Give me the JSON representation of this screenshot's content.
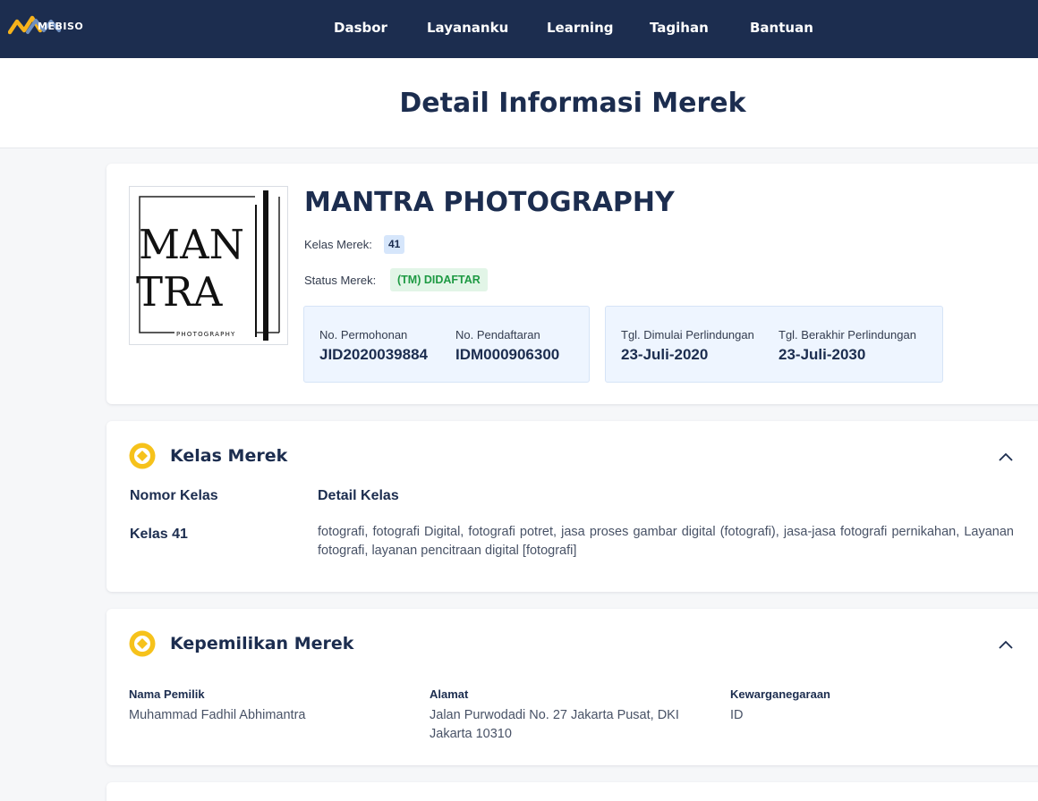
{
  "header": {
    "logo_text": "MEBISO",
    "nav": [
      "Dasbor",
      "Layananku",
      "Learning",
      "Tagihan",
      "Bantuan"
    ]
  },
  "page": {
    "title": "Detail Informasi Merek"
  },
  "brand": {
    "name": "MANTRA PHOTOGRAPHY",
    "logo_lettering": [
      "MAN",
      "TRA",
      "PHOTOGRAPHY"
    ],
    "class_label": "Kelas Merek:",
    "class_value": "41",
    "status_label": "Status Merek:",
    "status_value": "(TM) DIDAFTAR",
    "application_no_label": "No. Permohonan",
    "application_no": "JID2020039884",
    "registration_no_label": "No. Pendaftaran",
    "registration_no": "IDM000906300",
    "protection_start_label": "Tgl. Dimulai Perlindungan",
    "protection_start": "23-Juli-2020",
    "protection_end_label": "Tgl. Berakhir Perlindungan",
    "protection_end": "23-Juli-2030"
  },
  "class_section": {
    "title": "Kelas Merek",
    "col_number": "Nomor Kelas",
    "col_detail": "Detail Kelas",
    "number": "Kelas 41",
    "detail": "fotografi, fotografi Digital, fotografi potret, jasa proses gambar digital (fotografi), jasa-jasa fotografi pernikahan, Layanan fotografi, layanan pencitraan digital [fotografi]"
  },
  "ownership_section": {
    "title": "Kepemilikan Merek",
    "owner_label": "Nama Pemilik",
    "owner": "Muhammad Fadhil Abhimantra",
    "address_label": "Alamat",
    "address": "Jalan Purwodadi No. 27 Jakarta Pusat, DKI Jakarta 10310",
    "nationality_label": "Kewarganegaraan",
    "nationality": "ID"
  },
  "colors": {
    "navy": "#1c2d4f",
    "accent_yellow": "#f6c21b",
    "status_green": "#1e9a43",
    "info_bg": "#eef5ff"
  },
  "icons": {
    "section": "coin-diamond-icon",
    "collapse": "chevron-up-icon"
  }
}
